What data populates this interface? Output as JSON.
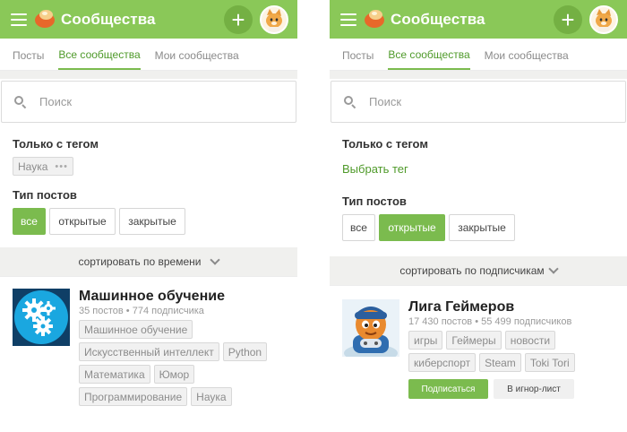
{
  "app": {
    "title": "Сообщества"
  },
  "tabs": [
    "Посты",
    "Все сообщества",
    "Мои сообщества"
  ],
  "search": {
    "placeholder": "Поиск"
  },
  "filters": {
    "tag_label": "Только с тегом",
    "post_type_label": "Тип постов",
    "post_types": [
      "все",
      "открытые",
      "закрытые"
    ]
  },
  "left": {
    "selected_tag": "Наука",
    "selected_tag_more": "•••",
    "active_post_type": "все",
    "sort_label": "сортировать по времени",
    "community": {
      "title": "Машинное обучение",
      "stats": "35 постов  •  774 подписчика",
      "tags": [
        "Машинное обучение",
        "Искусственный интеллект",
        "Python",
        "Математика",
        "Юмор",
        "Программирование",
        "Наука"
      ]
    }
  },
  "right": {
    "choose_tag": "Выбрать тег",
    "active_post_type": "открытые",
    "sort_label": "сортировать по подписчикам",
    "community": {
      "title": "Лига Геймеров",
      "stats": "17 430 постов  •  55 499 подписчиков",
      "tags": [
        "игры",
        "Геймеры",
        "новости",
        "киберспорт",
        "Steam",
        "Toki Tori"
      ],
      "subscribe_label": "Подписаться",
      "ignore_label": "В игнор-лист"
    }
  },
  "icons": {
    "menu": "hamburger-icon",
    "logo": "bun-logo-icon",
    "add": "plus-icon",
    "avatar": "cat-avatar",
    "search": "search-icon",
    "sort": "chevron-down-icon",
    "ml_image": "gears-icon",
    "gamers_image": "gamer-character-icon"
  },
  "colors": {
    "brand_green": "#8ac858",
    "accent_green": "#7bbb4e",
    "active_tab_text": "#4f9a2a",
    "ml_blue": "#1aa7e0"
  }
}
